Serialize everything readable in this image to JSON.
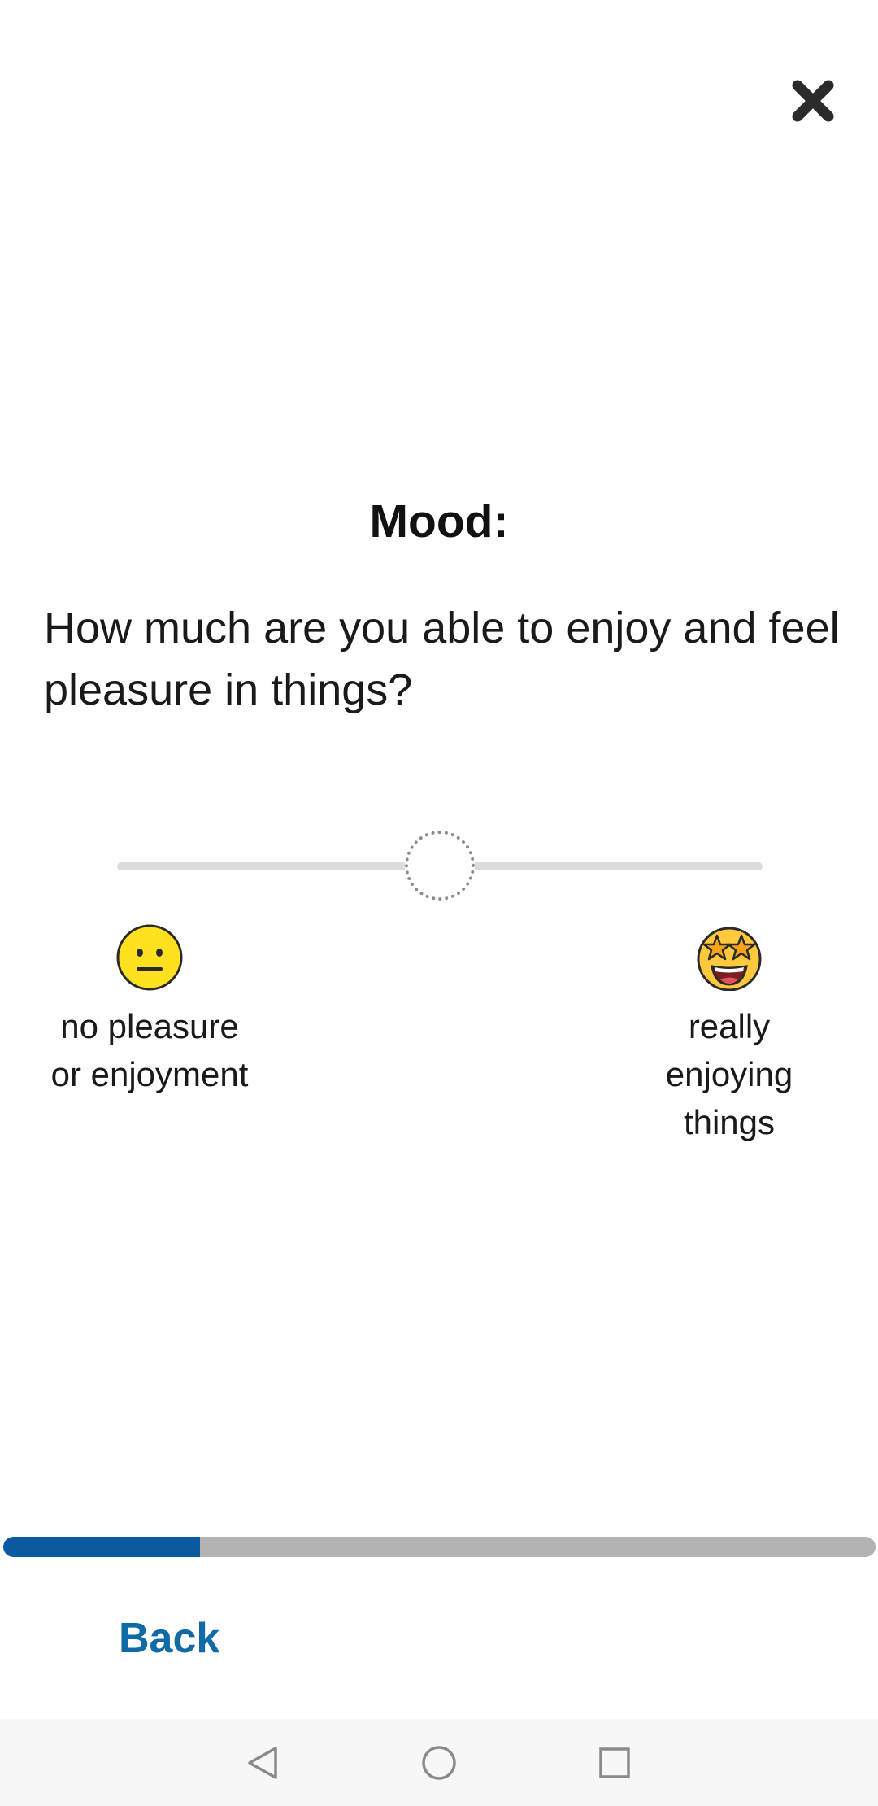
{
  "header": {
    "close_icon": "close-icon"
  },
  "survey": {
    "category": "Mood:",
    "question": "How much are you able to enjoy and feel pleasure in things?"
  },
  "slider": {
    "value_fraction": 0.5,
    "min_label": "no pleasure or enjoyment",
    "max_label": "really enjoying things",
    "min_icon": "neutral-face-icon",
    "max_icon": "star-struck-face-icon"
  },
  "progress": {
    "fraction": 0.226,
    "fill_color": "#0a5aa0",
    "track_color": "#b3b3b3"
  },
  "footer": {
    "back_label": "Back",
    "accent_color": "#0f6aa6"
  },
  "navbar": {
    "icons": [
      "back-triangle-icon",
      "home-circle-icon",
      "recents-square-icon"
    ]
  }
}
